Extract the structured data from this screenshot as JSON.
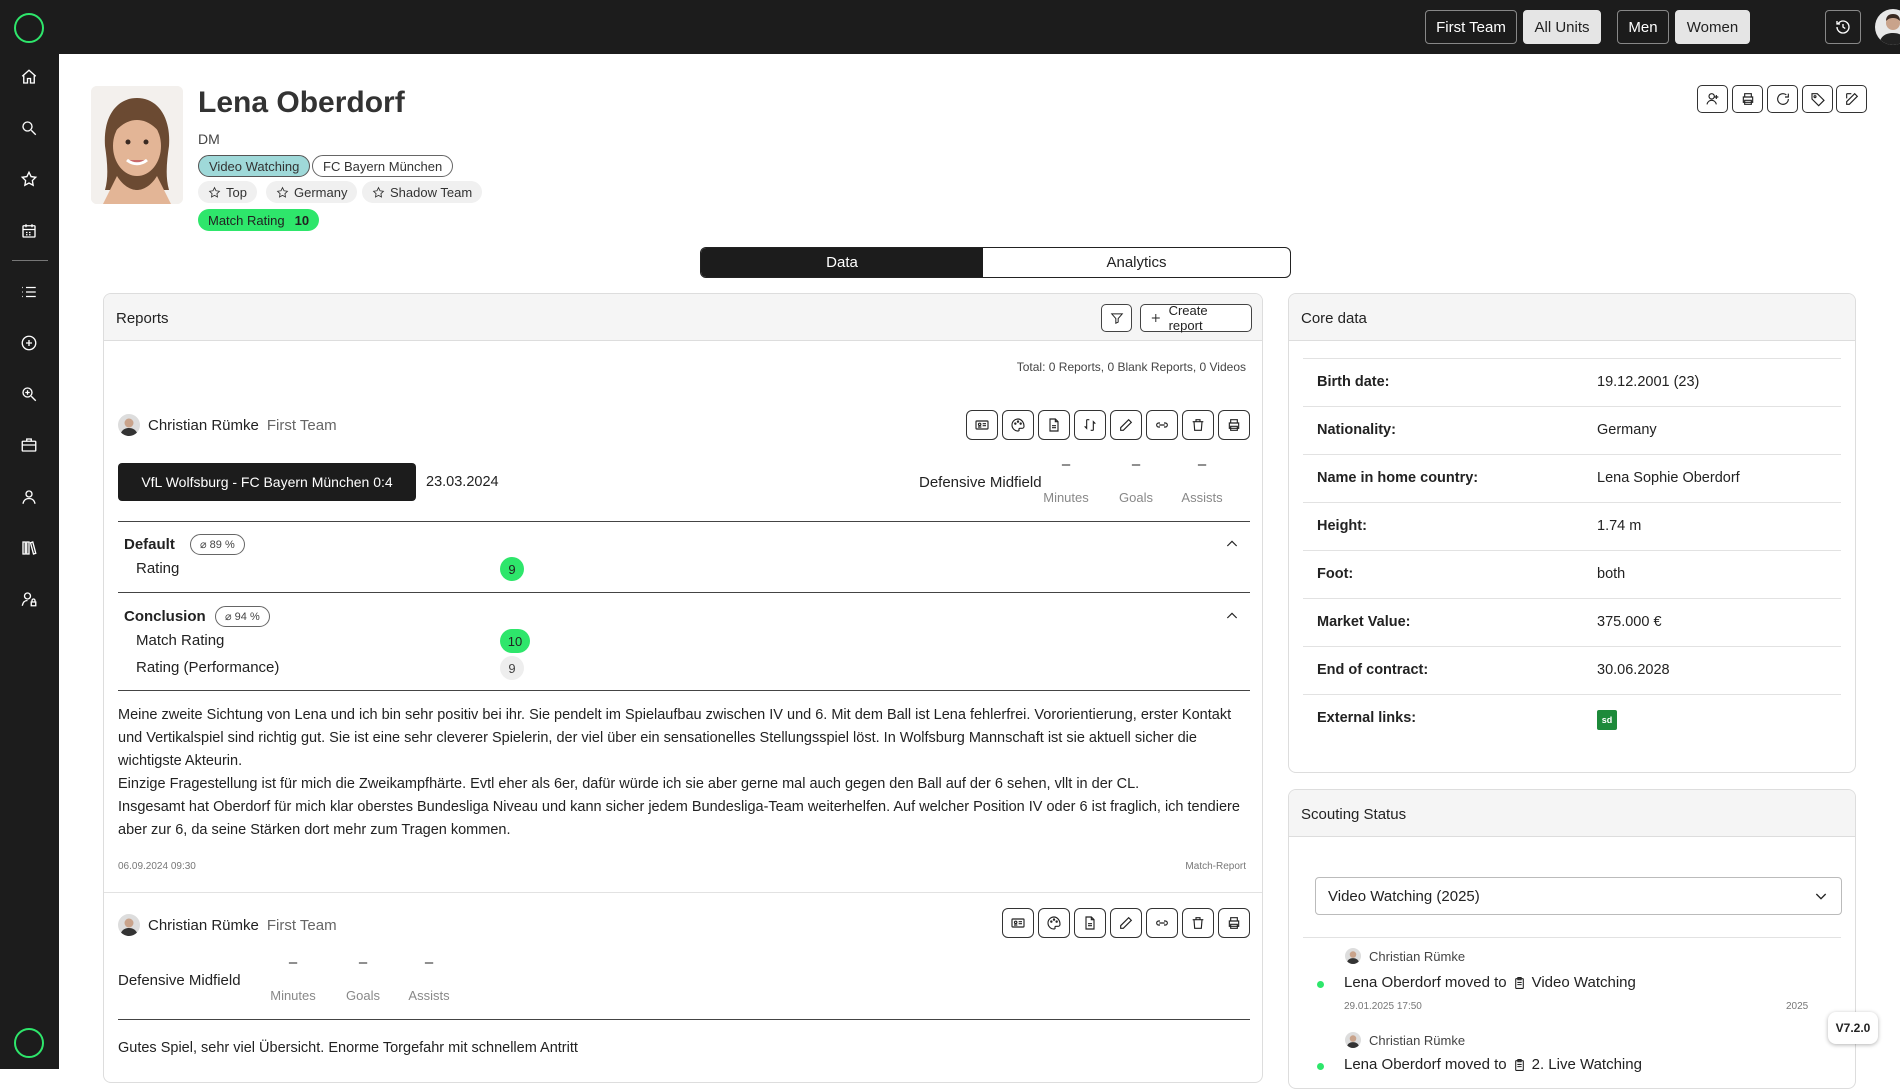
{
  "topbar": {
    "buttons": [
      "First Team",
      "All Units",
      "Men",
      "Women"
    ]
  },
  "player": {
    "name": "Lena Oberdorf",
    "position": "DM",
    "tags": [
      "Video Watching",
      "FC Bayern München"
    ],
    "star_tags": [
      "Top",
      "Germany",
      "Shadow Team"
    ],
    "match_rating_label": "Match Rating",
    "match_rating_value": "10"
  },
  "tabs": [
    "Data",
    "Analytics"
  ],
  "reports": {
    "title": "Reports",
    "create_label": "Create report",
    "total": "Total: 0 Reports, 0 Blank Reports, 0 Videos",
    "items": [
      {
        "author": "Christian Rümke",
        "team": "First Team",
        "match": "VfL Wolfsburg - FC Bayern München 0:4",
        "date": "23.03.2024",
        "position": "Defensive Midfield",
        "stats": [
          {
            "value": "–",
            "label": "Minutes"
          },
          {
            "value": "–",
            "label": "Goals"
          },
          {
            "value": "–",
            "label": "Assists"
          }
        ],
        "sections": [
          {
            "title": "Default",
            "pct": "⌀ 89 %",
            "rows": [
              {
                "label": "Rating",
                "value": "9"
              }
            ]
          },
          {
            "title": "Conclusion",
            "pct": "⌀ 94 %",
            "rows": [
              {
                "label": "Match Rating",
                "value": "10"
              },
              {
                "label": "Rating (Performance)",
                "value": "9"
              }
            ]
          }
        ],
        "text": [
          "Meine zweite Sichtung von Lena und ich bin sehr positiv bei ihr. Sie pendelt im Spielaufbau zwischen IV und 6. Mit dem Ball ist Lena fehlerfrei. Vororientierung, erster Kontakt und Vertikalspiel sind richtig gut. Sie ist eine sehr cleverer Spielerin, der viel über ein sensationelles Stellungsspiel löst. In Wolfsburg Mannschaft ist sie aktuell sicher die wichtigste Akteurin.",
          "Einzige Fragestellung ist für mich die Zweikampfhärte. Evtl eher als 6er, dafür würde ich sie aber gerne mal auch gegen den Ball auf der 6 sehen, vllt in der CL.",
          "Insgesamt hat Oberdorf für mich klar oberstes Bundesliga Niveau und kann sicher jedem Bundesliga-Team weiterhelfen. Auf welcher Position IV oder 6 ist fraglich, ich tendiere aber zur 6, da seine Stärken dort mehr zum Tragen kommen."
        ],
        "timestamp": "06.09.2024 09:30",
        "type": "Match-Report"
      },
      {
        "author": "Christian Rümke",
        "team": "First Team",
        "position": "Defensive Midfield",
        "stats": [
          {
            "value": "–",
            "label": "Minutes"
          },
          {
            "value": "–",
            "label": "Goals"
          },
          {
            "value": "–",
            "label": "Assists"
          }
        ],
        "text": [
          "Gutes Spiel, sehr viel Übersicht. Enorme Torgefahr mit schnellem Antritt"
        ]
      }
    ]
  },
  "core_data": {
    "title": "Core data",
    "rows": [
      {
        "label": "Birth date:",
        "value": "19.12.2001 (23)"
      },
      {
        "label": "Nationality:",
        "value": "Germany"
      },
      {
        "label": "Name in home country:",
        "value": "Lena Sophie Oberdorf"
      },
      {
        "label": "Height:",
        "value": "1.74 m"
      },
      {
        "label": "Foot:",
        "value": "both"
      },
      {
        "label": "Market Value:",
        "value": "375.000 €"
      },
      {
        "label": "End of contract:",
        "value": "30.06.2028"
      },
      {
        "label": "External links:",
        "value": "sd"
      }
    ]
  },
  "scouting": {
    "title": "Scouting Status",
    "selected": "Video Watching (2025)",
    "entries": [
      {
        "author": "Christian Rümke",
        "text": "Lena Oberdorf moved to",
        "target": "Video Watching",
        "timestamp": "29.01.2025 17:50",
        "year": "2025"
      },
      {
        "author": "Christian Rümke",
        "text": "Lena Oberdorf moved to",
        "target": "2. Live Watching"
      }
    ]
  },
  "version": "V7.2.0",
  "colors": {
    "accent": "#2ee66b",
    "dark": "#1c1c1c",
    "teal": "#9fd9d9"
  }
}
